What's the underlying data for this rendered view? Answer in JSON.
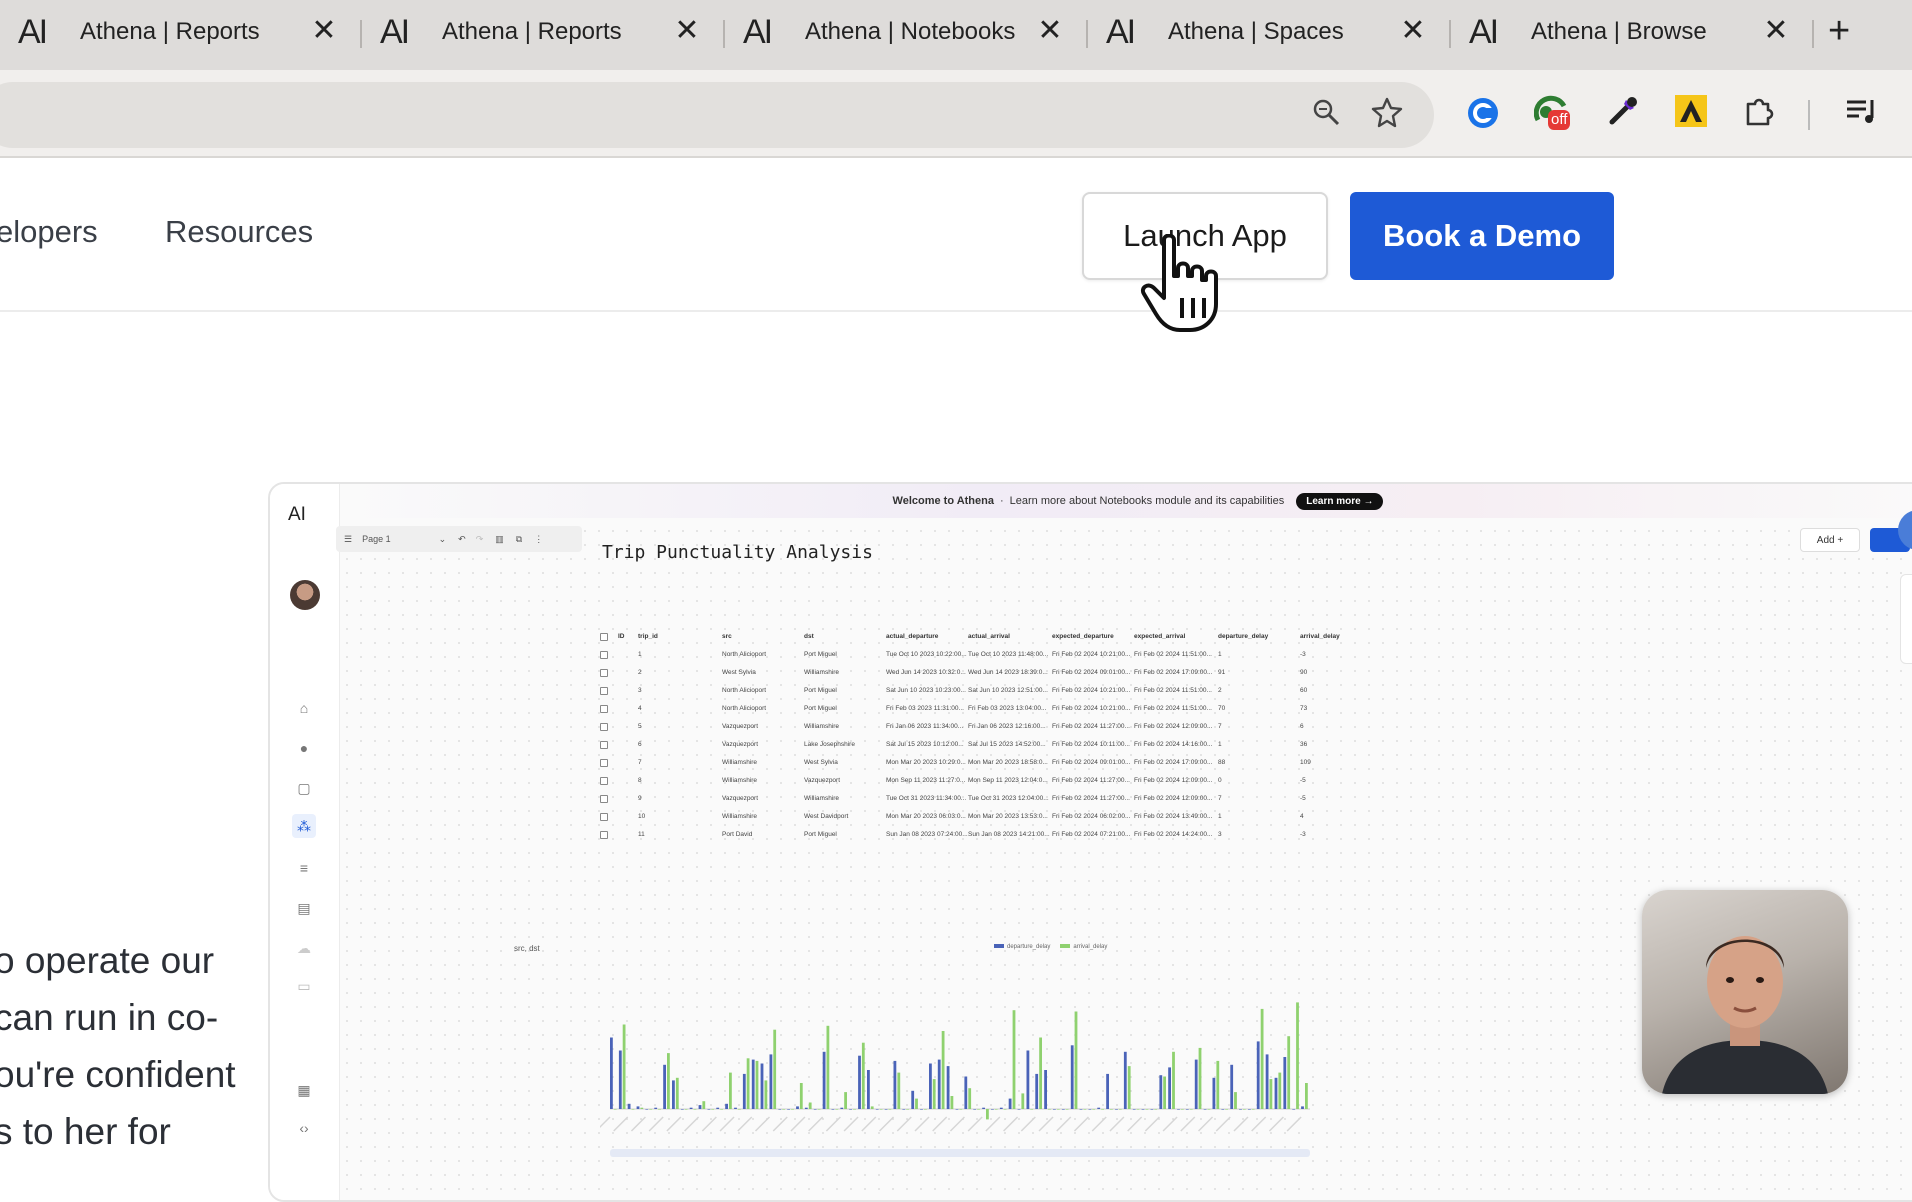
{
  "browser": {
    "tabs": [
      {
        "logo": "AI",
        "title": "Athena | Reports"
      },
      {
        "logo": "AI",
        "title": "Athena | Reports"
      },
      {
        "logo": "AI",
        "title": "Athena | Notebooks"
      },
      {
        "logo": "AI",
        "title": "Athena | Spaces"
      },
      {
        "logo": "AI",
        "title": "Athena | Browse"
      }
    ],
    "close_glyph": "✕",
    "new_tab_glyph": "+",
    "toolbar_icons": [
      "zoom-icon",
      "bookmark-star-icon",
      "extension-refresh-icon",
      "extension-off-icon",
      "eyedropper-icon",
      "extension-triangle-icon",
      "extensions-puzzle-icon",
      "media-playlist-icon"
    ],
    "off_badge": "off"
  },
  "site": {
    "nav": {
      "developers": "elopers",
      "resources": "Resources"
    },
    "launch_app": "Launch App",
    "book_demo": "Book a Demo",
    "hero_lines": [
      "o operate our",
      "can run in co-",
      "ou're confident",
      "s to her for"
    ]
  },
  "preview": {
    "logo": "AI",
    "banner": {
      "bold": "Welcome to Athena",
      "text": "Learn more about Notebooks module and its capabilities",
      "cta": "Learn more →"
    },
    "page_select": "Page 1",
    "add_button": "Add +",
    "notebook_title": "Trip Punctuality Analysis",
    "table": {
      "columns": [
        "ID",
        "trip_id",
        "src",
        "dst",
        "actual_departure",
        "actual_arrival",
        "expected_departure",
        "expected_arrival",
        "departure_delay",
        "arrival_delay"
      ],
      "rows": [
        [
          "1",
          "North Alicioport",
          "Port Miguel",
          "Tue Oct 10 2023 10:22:00...",
          "Tue Oct 10 2023 11:48:00...",
          "Fri Feb 02 2024 10:21:00...",
          "Fri Feb 02 2024 11:51:00...",
          "1",
          "-3"
        ],
        [
          "2",
          "West Sylvia",
          "Williamshire",
          "Wed Jun 14 2023 10:32:0...",
          "Wed Jun 14 2023 18:39:0...",
          "Fri Feb 02 2024 09:01:00...",
          "Fri Feb 02 2024 17:09:00...",
          "91",
          "90"
        ],
        [
          "3",
          "North Alicioport",
          "Port Miguel",
          "Sat Jun 10 2023 10:23:00...",
          "Sat Jun 10 2023 12:51:00...",
          "Fri Feb 02 2024 10:21:00...",
          "Fri Feb 02 2024 11:51:00...",
          "2",
          "60"
        ],
        [
          "4",
          "North Alicioport",
          "Port Miguel",
          "Fri Feb 03 2023 11:31:00...",
          "Fri Feb 03 2023 13:04:00...",
          "Fri Feb 02 2024 10:21:00...",
          "Fri Feb 02 2024 11:51:00...",
          "70",
          "73"
        ],
        [
          "5",
          "Vazquezport",
          "Williamshire",
          "Fri Jan 06 2023 11:34:00...",
          "Fri Jan 06 2023 12:16:00...",
          "Fri Feb 02 2024 11:27:00...",
          "Fri Feb 02 2024 12:09:00...",
          "7",
          "6"
        ],
        [
          "6",
          "Vazquezport",
          "Lake Josephshire",
          "Sat Jul 15 2023 10:12:00...",
          "Sat Jul 15 2023 14:52:00...",
          "Fri Feb 02 2024 10:11:00...",
          "Fri Feb 02 2024 14:16:00...",
          "1",
          "36"
        ],
        [
          "7",
          "Williamshire",
          "West Sylvia",
          "Mon Mar 20 2023 10:29:0...",
          "Mon Mar 20 2023 18:58:0...",
          "Fri Feb 02 2024 09:01:00...",
          "Fri Feb 02 2024 17:09:00...",
          "88",
          "109"
        ],
        [
          "8",
          "Williamshire",
          "Vazquezport",
          "Mon Sep 11 2023 11:27:0...",
          "Mon Sep 11 2023 12:04:0...",
          "Fri Feb 02 2024 11:27:00...",
          "Fri Feb 02 2024 12:09:00...",
          "0",
          "-5"
        ],
        [
          "9",
          "Vazquezport",
          "Williamshire",
          "Tue Oct 31 2023 11:34:00...",
          "Tue Oct 31 2023 12:04:00...",
          "Fri Feb 02 2024 11:27:00...",
          "Fri Feb 02 2024 12:09:00...",
          "7",
          "-5"
        ],
        [
          "10",
          "Williamshire",
          "West Davidport",
          "Mon Mar 20 2023 06:03:0...",
          "Mon Mar 20 2023 13:53:0...",
          "Fri Feb 02 2024 06:02:00...",
          "Fri Feb 02 2024 13:49:00...",
          "1",
          "4"
        ],
        [
          "11",
          "Port David",
          "Port Miguel",
          "Sun Jan 08 2023 07:24:00...",
          "Sun Jan 08 2023 14:21:00...",
          "Fri Feb 02 2024 07:21:00...",
          "Fri Feb 02 2024 14:24:00...",
          "3",
          "-3"
        ]
      ]
    },
    "chart_label": "src, dst",
    "legend": [
      "departure_delay",
      "arrival_delay"
    ]
  },
  "chart_data": {
    "type": "bar",
    "series": [
      {
        "name": "departure_delay",
        "color": "#4a63b8",
        "values": [
          55,
          45,
          4,
          2,
          0,
          1,
          34,
          22,
          0,
          1,
          3,
          0,
          1,
          4,
          1,
          27,
          38,
          35,
          42,
          0,
          0,
          2,
          1,
          0,
          44,
          0,
          1,
          0,
          41,
          30,
          0,
          0,
          37,
          0,
          14,
          0,
          35,
          38,
          33,
          0,
          25,
          0,
          1,
          0,
          1,
          8,
          0,
          45,
          27,
          30,
          0,
          0,
          49,
          0,
          0,
          1,
          27,
          0,
          44,
          0,
          0,
          0,
          26,
          32,
          0,
          0,
          38,
          0,
          24,
          0,
          34,
          0,
          0,
          52,
          42,
          24,
          40,
          0,
          2
        ]
      },
      {
        "name": "arrival_delay",
        "color": "#8fd16f",
        "values": [
          0,
          65,
          0,
          1,
          0,
          0,
          43,
          24,
          0,
          0,
          6,
          0,
          0,
          28,
          0,
          39,
          37,
          22,
          61,
          0,
          0,
          20,
          5,
          0,
          64,
          0,
          13,
          0,
          51,
          2,
          0,
          0,
          28,
          0,
          8,
          0,
          23,
          60,
          10,
          0,
          16,
          0,
          -8,
          0,
          0,
          76,
          12,
          0,
          55,
          0,
          0,
          0,
          75,
          0,
          0,
          0,
          0,
          0,
          33,
          0,
          0,
          0,
          25,
          44,
          0,
          0,
          47,
          0,
          37,
          0,
          13,
          0,
          0,
          77,
          23,
          28,
          56,
          82,
          20
        ]
      }
    ]
  }
}
